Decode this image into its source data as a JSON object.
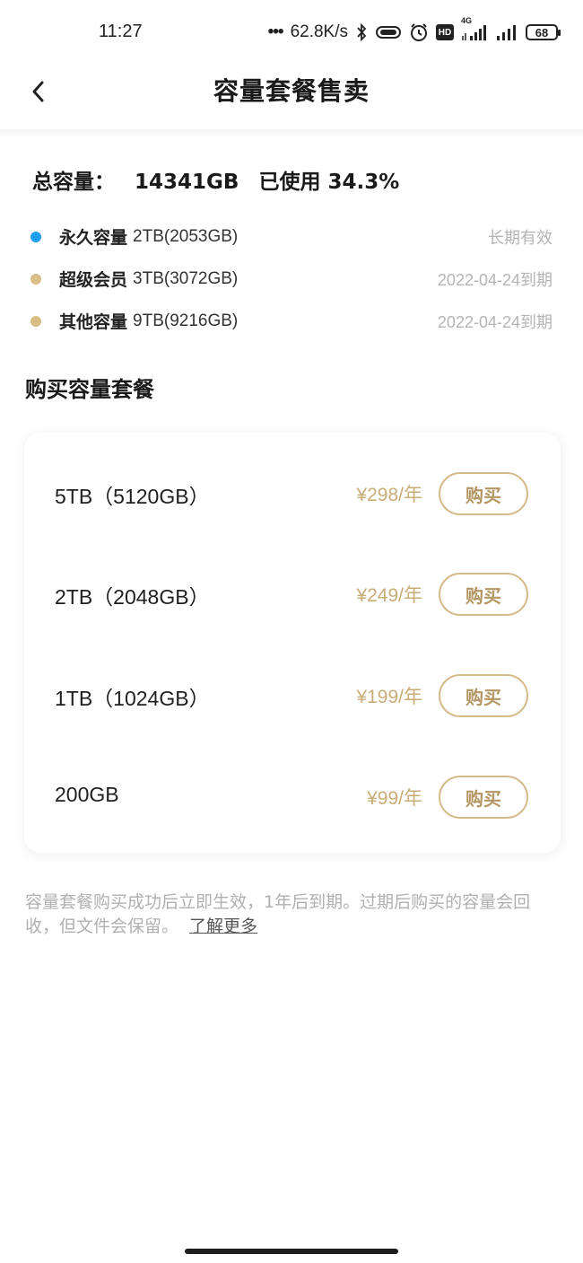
{
  "status_bar": {
    "time": "11:27",
    "network_speed": "62.8K/s",
    "network_type": "4G",
    "hd_label": "HD",
    "battery": "68"
  },
  "header": {
    "title": "容量套餐售卖",
    "back_icon": "chevron-left-icon"
  },
  "summary": {
    "label": "总容量：",
    "total": "14341GB",
    "used_text": "已使用 34.3%"
  },
  "capacities": [
    {
      "name": "永久容量",
      "size": "2TB(2053GB)",
      "expire": "长期有效",
      "color": "#1e9ff2"
    },
    {
      "name": "超级会员",
      "size": "3TB(3072GB)",
      "expire": "2022-04-24到期",
      "color": "#d9bd84"
    },
    {
      "name": "其他容量",
      "size": "9TB(9216GB)",
      "expire": "2022-04-24到期",
      "color": "#d9bd84"
    }
  ],
  "section_title": "购买容量套餐",
  "packages": [
    {
      "name": "5TB（5120GB）",
      "price": "¥298/年",
      "button": "购买"
    },
    {
      "name": "2TB（2048GB）",
      "price": "¥249/年",
      "button": "购买"
    },
    {
      "name": "1TB（1024GB）",
      "price": "¥199/年",
      "button": "购买"
    },
    {
      "name": "200GB",
      "price": "¥99/年",
      "button": "购买"
    }
  ],
  "footnote": {
    "text": "容量套餐购买成功后立即生效，1年后到期。过期后购买的容量会回收，但文件会保留。",
    "link": "了解更多"
  },
  "colors": {
    "accent_gold": "#c9ad77",
    "button_border": "#d5bb8c",
    "permanent_blue": "#1e9ff2"
  }
}
